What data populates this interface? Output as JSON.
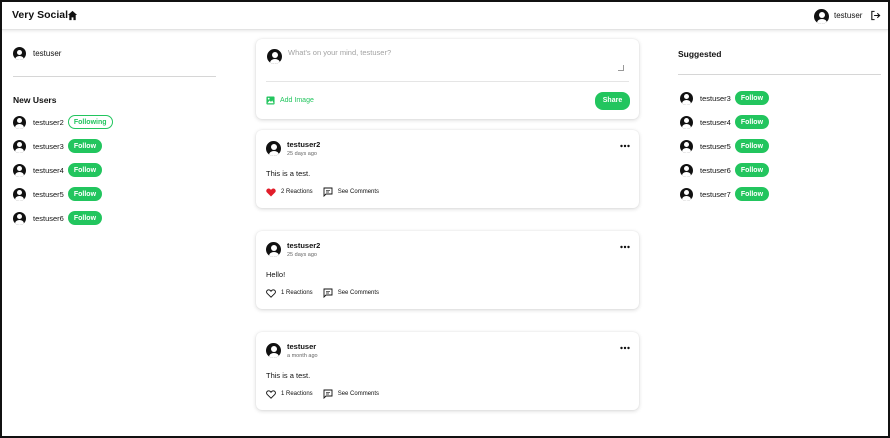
{
  "header": {
    "brand": "Very Social",
    "icons": {
      "home": "home-icon",
      "logout": "logout-icon"
    },
    "username": "testuser"
  },
  "left": {
    "current_user": "testuser",
    "new_users_title": "New Users",
    "users": [
      {
        "name": "testuser2",
        "action": "Following",
        "following": true
      },
      {
        "name": "testuser3",
        "action": "Follow",
        "following": false
      },
      {
        "name": "testuser4",
        "action": "Follow",
        "following": false
      },
      {
        "name": "testuser5",
        "action": "Follow",
        "following": false
      },
      {
        "name": "testuser6",
        "action": "Follow",
        "following": false
      }
    ]
  },
  "composer": {
    "placeholder": "What's on your mind, testuser?",
    "add_image_label": "Add Image",
    "share_label": "Share"
  },
  "posts": [
    {
      "author": "testuser2",
      "time": "25 days ago",
      "body": "This is a test.",
      "reactions": "2 Reactions",
      "reacted": true,
      "comments": "See Comments"
    },
    {
      "author": "testuser2",
      "time": "25 days ago",
      "body": "Hello!",
      "reactions": "1 Reactions",
      "reacted": false,
      "comments": "See Comments"
    },
    {
      "author": "testuser",
      "time": "a month ago",
      "body": "This is a test.",
      "reactions": "1 Reactions",
      "reacted": false,
      "comments": "See Comments"
    }
  ],
  "right": {
    "suggested_title": "Suggested",
    "users": [
      {
        "name": "testuser3",
        "action": "Follow"
      },
      {
        "name": "testuser4",
        "action": "Follow"
      },
      {
        "name": "testuser5",
        "action": "Follow"
      },
      {
        "name": "testuser6",
        "action": "Follow"
      },
      {
        "name": "testuser7",
        "action": "Follow"
      }
    ]
  },
  "colors": {
    "accent": "#22c55e",
    "heart": "#e11d2a",
    "text": "#111111"
  }
}
